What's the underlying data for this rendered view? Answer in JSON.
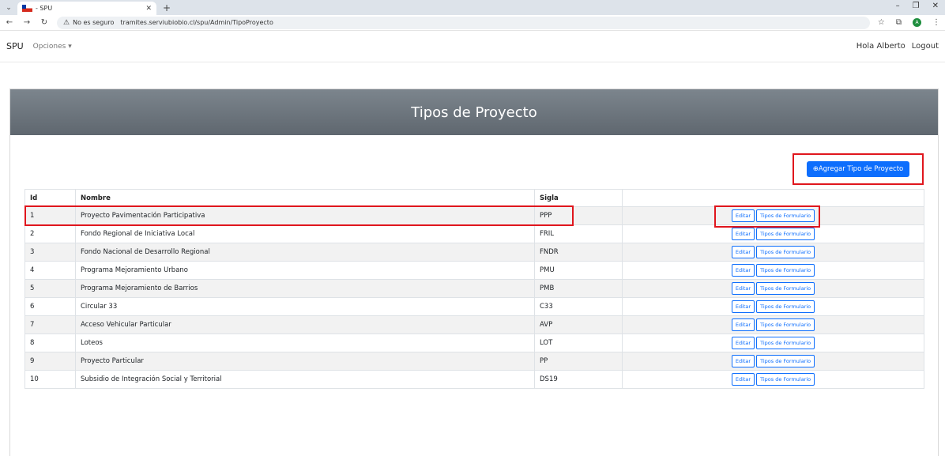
{
  "browser": {
    "tab_title": "- SPU",
    "new_tab": "+",
    "security_label": "No es seguro",
    "url": "tramites.serviubiobio.cl/spu/Admin/TipoProyecto",
    "profile_initial": "A"
  },
  "navbar": {
    "brand": "SPU",
    "menu_label": "Opciones ▾",
    "greeting": "Hola Alberto",
    "logout": "Logout"
  },
  "page": {
    "title": "Tipos de Proyecto",
    "add_button": "⊕Agregar Tipo de Proyecto"
  },
  "table": {
    "headers": {
      "id": "Id",
      "nombre": "Nombre",
      "sigla": "Sigla"
    },
    "edit_label": "Editar",
    "forms_label": "Tipos de Formulario",
    "rows": [
      {
        "id": "1",
        "nombre": "Proyecto Pavimentación Participativa",
        "sigla": "PPP"
      },
      {
        "id": "2",
        "nombre": "Fondo Regional de Iniciativa Local",
        "sigla": "FRIL"
      },
      {
        "id": "3",
        "nombre": "Fondo Nacional de Desarrollo Regional",
        "sigla": "FNDR"
      },
      {
        "id": "4",
        "nombre": "Programa Mejoramiento Urbano",
        "sigla": "PMU"
      },
      {
        "id": "5",
        "nombre": "Programa Mejoramiento de Barrios",
        "sigla": "PMB"
      },
      {
        "id": "6",
        "nombre": "Circular 33",
        "sigla": "C33"
      },
      {
        "id": "7",
        "nombre": "Acceso Vehicular Particular",
        "sigla": "AVP"
      },
      {
        "id": "8",
        "nombre": "Loteos",
        "sigla": "LOT"
      },
      {
        "id": "9",
        "nombre": "Proyecto Particular",
        "sigla": "PP"
      },
      {
        "id": "10",
        "nombre": "Subsidio de Integración Social y Territorial",
        "sigla": "DS19"
      }
    ]
  },
  "colors": {
    "primary": "#0d6efd",
    "highlight": "#e0161d",
    "header_bg": "#6c757d"
  }
}
